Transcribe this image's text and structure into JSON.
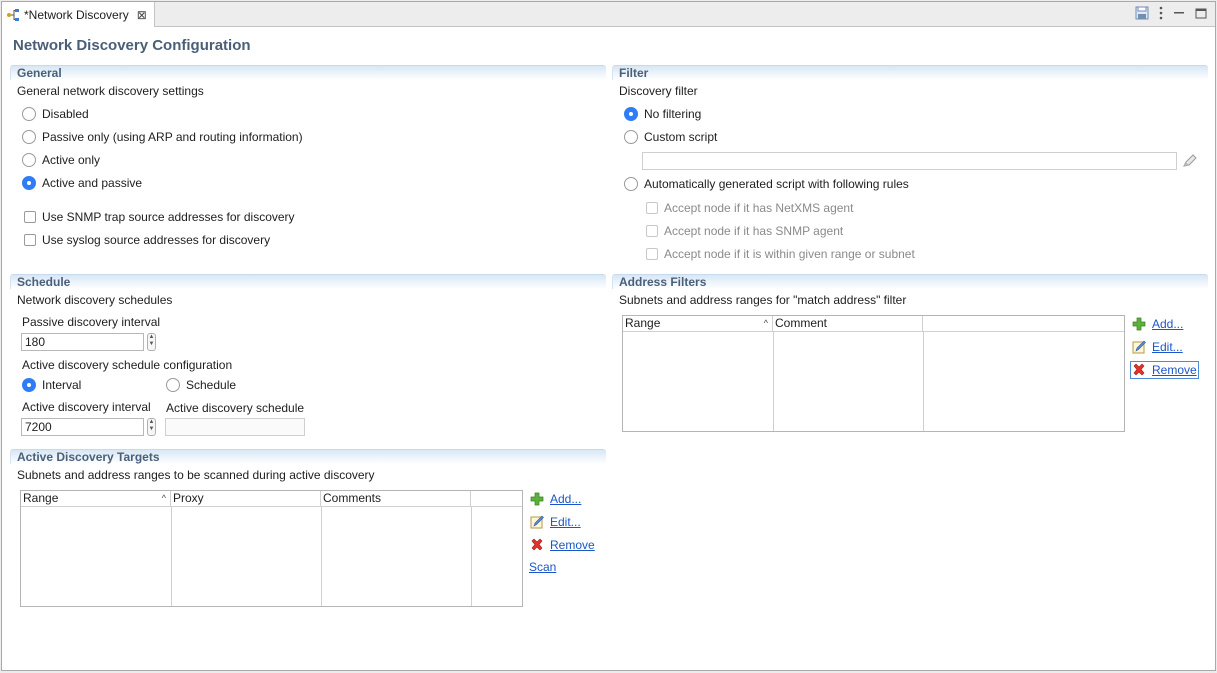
{
  "tab": {
    "title": "*Network Discovery",
    "close": "⊠"
  },
  "page_title": "Network Discovery Configuration",
  "general": {
    "heading": "General",
    "description": "General network discovery settings",
    "options": [
      "Disabled",
      "Passive only (using ARP and routing information)",
      "Active only",
      "Active and passive"
    ],
    "selected": "Active and passive",
    "checks": [
      "Use SNMP trap source addresses for discovery",
      "Use syslog source addresses for discovery"
    ]
  },
  "filter": {
    "heading": "Filter",
    "description": "Discovery filter",
    "opt_none": "No filtering",
    "opt_custom": "Custom script",
    "opt_auto": "Automatically generated script with following rules",
    "rules": [
      "Accept node if it has NetXMS agent",
      "Accept node if it has SNMP agent",
      "Accept node if it is within given range or subnet"
    ]
  },
  "schedule": {
    "heading": "Schedule",
    "description": "Network discovery schedules",
    "passive_label": "Passive discovery interval",
    "passive_value": "180",
    "active_config_label": "Active discovery schedule configuration",
    "opt_interval": "Interval",
    "opt_schedule": "Schedule",
    "active_interval_label": "Active discovery interval",
    "active_interval_value": "7200",
    "active_schedule_label": "Active discovery schedule"
  },
  "targets": {
    "heading": "Active Discovery Targets",
    "description": "Subnets and address ranges to be scanned during active discovery",
    "columns": [
      "Range",
      "Proxy",
      "Comments"
    ],
    "actions": {
      "add": "Add...",
      "edit": "Edit...",
      "remove": "Remove",
      "scan": "Scan"
    }
  },
  "address_filters": {
    "heading": "Address Filters",
    "description": "Subnets and address ranges for \"match address\" filter",
    "columns": [
      "Range",
      "Comment"
    ],
    "actions": {
      "add": "Add...",
      "edit": "Edit...",
      "remove": "Remove"
    }
  },
  "sort_glyph": "^",
  "colors": {
    "section_text": "#4a6079",
    "accent": "#2f7df6",
    "link": "#1a56c8"
  }
}
